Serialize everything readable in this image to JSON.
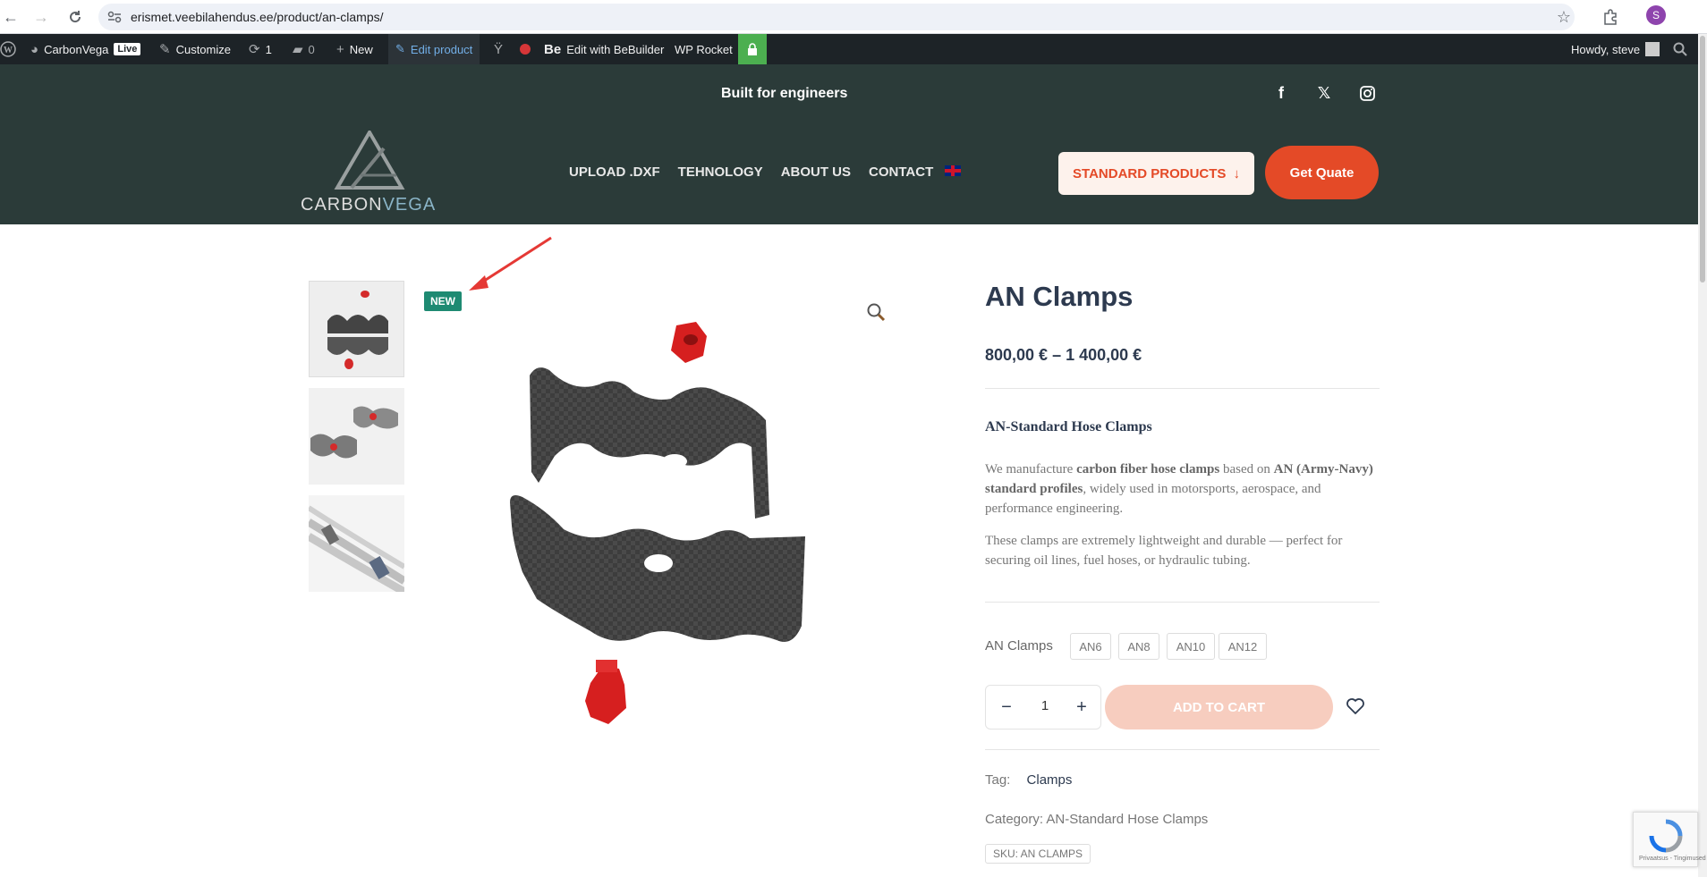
{
  "browser": {
    "url": "erismet.veebilahendus.ee/product/an-clamps/",
    "profile_initial": "S"
  },
  "adminbar": {
    "site_name": "CarbonVega",
    "live_label": "Live",
    "customize": "Customize",
    "updates_count": "1",
    "comments_count": "0",
    "new_label": "New",
    "edit_product": "Edit product",
    "bebuilder": "Edit with BeBuilder",
    "bebuilder_mark": "Be",
    "wp_rocket": "WP Rocket",
    "howdy": "Howdy, steve"
  },
  "header": {
    "tagline": "Built for engineers",
    "logo_part1": "CARBON",
    "logo_part2": "VEGA",
    "nav": [
      "UPLOAD .DXF",
      "TEHNOLOGY",
      "ABOUT US",
      "CONTACT"
    ],
    "standard_products": "STANDARD PRODUCTS",
    "get_quote": "Get Quate"
  },
  "gallery": {
    "badge": "NEW"
  },
  "product": {
    "title": "AN Clamps",
    "price": "800,00 € – 1 400,00 €",
    "desc_heading": "AN-Standard Hose Clamps",
    "desc_p1_a": "We manufacture ",
    "desc_p1_b": "carbon fiber hose clamps",
    "desc_p1_c": " based on ",
    "desc_p1_d": "AN (Army-Navy) standard profiles",
    "desc_p1_e": ", widely used in motorsports, aerospace, and performance engineering.",
    "desc_p2": "These clamps are extremely lightweight and durable — perfect for securing oil lines, fuel hoses, or hydraulic tubing.",
    "variation_label": "AN Clamps",
    "variations": [
      "AN6",
      "AN8",
      "AN10",
      "AN12"
    ],
    "qty": "1",
    "add_to_cart": "ADD TO CART",
    "tag_label": "Tag:",
    "tag_value": "Clamps",
    "category_label": "Category:",
    "category_value": "AN-Standard Hose Clamps",
    "sku": "SKU: AN CLAMPS"
  },
  "recaptcha": {
    "footer": "Privaatsus - Tingimused"
  },
  "colors": {
    "header_bg": "#2b3b39",
    "accent": "#e44a27",
    "badge": "#1e8a72"
  }
}
